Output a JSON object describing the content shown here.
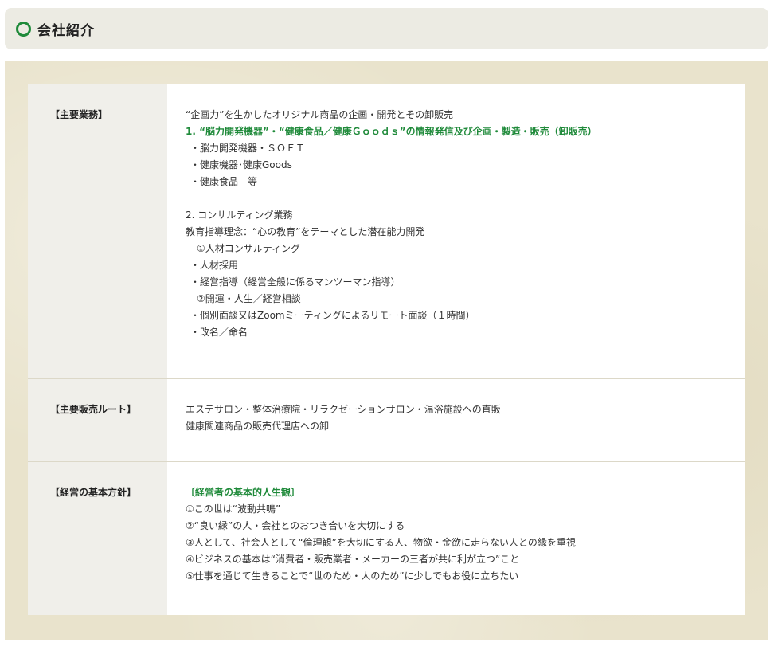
{
  "header": {
    "title": "会社紹介"
  },
  "rows": [
    {
      "label": "【主要業務】",
      "lines": [
        "“企画力”を生かしたオリジナル商品の企画・開発とその卸販売",
        "1. “脳力開発機器”・“健康食品／健康Ｇｏｏｄｓ”の情報発信及び企画・製造・販売（卸販売）",
        "・脳力開発機器・ＳＯＦＴ",
        "・健康機器･健康Goods",
        "・健康食品　等",
        "2. コンサルティング業務",
        "教育指導理念：“心の教育”をテーマとした潜在能力開発",
        "①人材コンサルティング",
        "・人材採用",
        "・経営指導（経営全般に係るマンツーマン指導）",
        "②開運・人生／経営相談",
        "・個別面談又はZoomミーティングによるリモート面談（１時間）",
        "・改名／命名"
      ]
    },
    {
      "label": "【主要販売ルート】",
      "lines": [
        "エステサロン・整体治療院・リラクゼーションサロン・温浴施設への直販",
        "健康関連商品の販売代理店への卸"
      ]
    },
    {
      "label": "【経営の基本方針】",
      "lines": [
        "〔経営者の基本的人生観〕",
        "①この世は“波動共鳴”",
        "②“良い縁”の人・会社とのおつき合いを大切にする",
        "③人として、社会人として“倫理観”を大切にする人、物欲・金欲に走らない人との縁を重視",
        "④ビジネスの基本は“消費者・販売業者・メーカーの三者が共に利が立つ”こと",
        "⑤仕事を通じて生きることで“世のため・人のため”に少しでもお役に立ちたい"
      ]
    }
  ],
  "colors": {
    "accent_green": "#1f8a3a",
    "panel_bg": "#e9e3cc",
    "label_bg": "#f0efea"
  }
}
